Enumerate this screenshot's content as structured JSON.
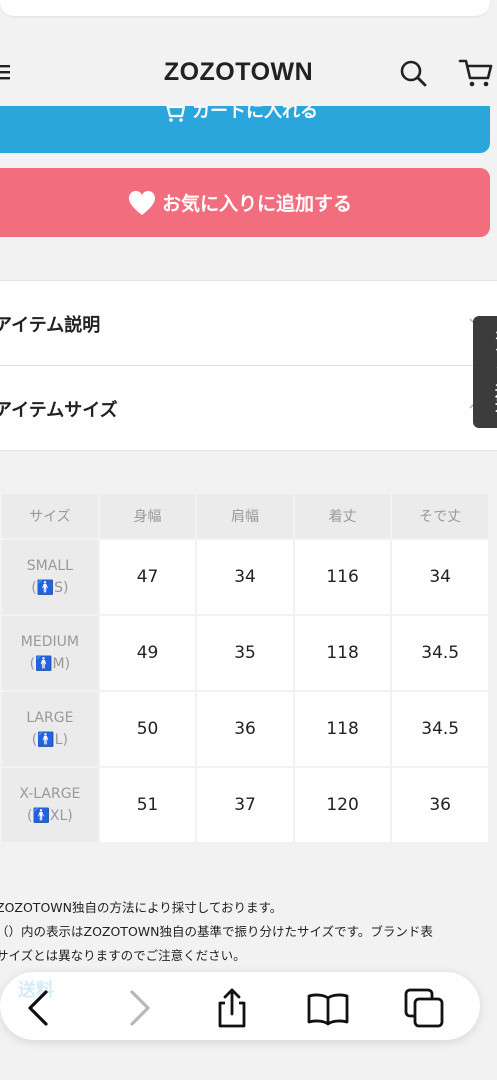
{
  "header": {
    "logo": "ZOZOTOWN",
    "icons": [
      "menu-icon",
      "search-icon",
      "cart-icon"
    ]
  },
  "buttons": {
    "cart_label": "カートに入れる",
    "favorite_label": "お気に入りに追加する"
  },
  "accordion": {
    "items": [
      {
        "label": "アイテム説明"
      },
      {
        "label": "アイテムサイズ"
      }
    ]
  },
  "side_tab": {
    "label": "ポイント還元"
  },
  "size_table": {
    "headers": [
      "サイズ",
      "身幅",
      "肩幅",
      "着丈",
      "そで丈"
    ],
    "rows": [
      {
        "size": "SMALL",
        "tag": "S",
        "values": [
          "47",
          "34",
          "116",
          "34"
        ]
      },
      {
        "size": "MEDIUM",
        "tag": "M",
        "values": [
          "49",
          "35",
          "118",
          "34.5"
        ]
      },
      {
        "size": "LARGE",
        "tag": "L",
        "values": [
          "50",
          "36",
          "118",
          "34.5"
        ]
      },
      {
        "size": "X-LARGE",
        "tag": "XL",
        "values": [
          "51",
          "37",
          "120",
          "36"
        ]
      }
    ]
  },
  "notes": {
    "line1": "ZOZOTOWN独自の方法により採寸しております。",
    "line2": "（）内の表示はZOZOTOWN独自の基準で振り分けたサイズです。ブランド表",
    "line3": "サイズとは異なりますのでご注意ください。"
  },
  "browser_bar": {
    "ghost_text": "送料",
    "buttons": [
      "back-icon",
      "forward-icon",
      "share-icon",
      "bookmarks-icon",
      "tabs-icon"
    ]
  },
  "colors": {
    "cart_button": "#2aa6dc",
    "favorite_button": "#f26d7d",
    "size_person_icon": "#e0464e"
  }
}
